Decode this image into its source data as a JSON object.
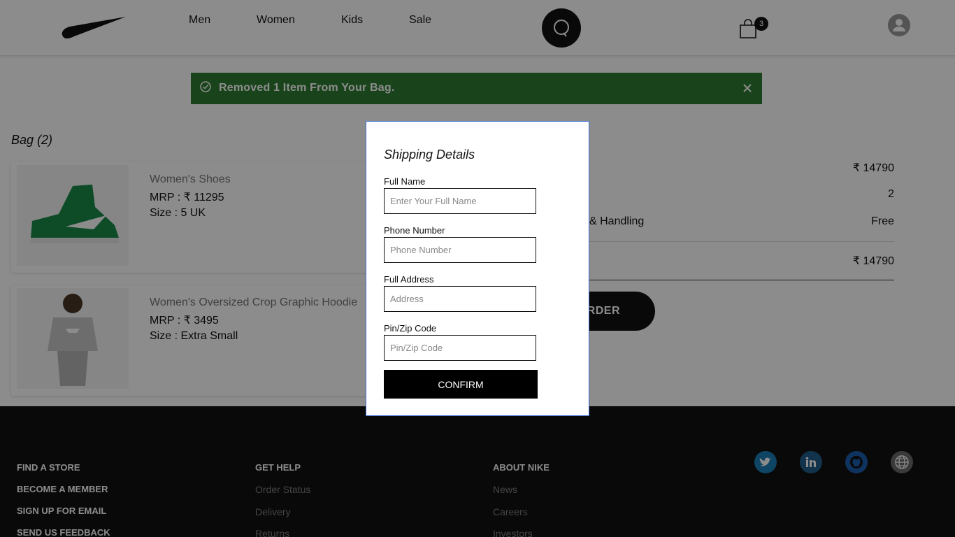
{
  "header": {
    "logo_icon": "nike-swoosh-logo",
    "nav": [
      {
        "label": "Men"
      },
      {
        "label": "Women"
      },
      {
        "label": "Kids"
      },
      {
        "label": "Sale"
      }
    ],
    "search_icon": "search-icon",
    "cart_icon": "shopping-bag-icon",
    "cart_count": "3",
    "avatar_icon": "user-avatar-icon"
  },
  "toast": {
    "icon": "check-circle-icon",
    "message": "Removed 1 Item From Your Bag.",
    "close_icon": "close-icon",
    "color": "#2e7d32"
  },
  "bag": {
    "title": "Bag (2)",
    "items": [
      {
        "name": "Women's Shoes",
        "price": "MRP : ₹ 11295",
        "size": "Size : 5 UK",
        "image": "green-high-top-sneaker"
      },
      {
        "name": "Women's Oversized Crop Graphic Hoodie",
        "price": "MRP : ₹ 3495",
        "size": "Size : Extra Small",
        "image": "grey-hoodie-model"
      }
    ]
  },
  "summary": {
    "subtotal_value": "₹ 14790",
    "items_value": "2",
    "shipping_label": "& Handling",
    "shipping_value": "Free",
    "total_value": "₹ 14790",
    "order_button": "RDER"
  },
  "footer": {
    "col1": [
      "FIND A STORE",
      "BECOME A MEMBER",
      "SIGN UP FOR EMAIL",
      "SEND US FEEDBACK"
    ],
    "col2_head": "GET HELP",
    "col2": [
      "Order Status",
      "Delivery",
      "Returns"
    ],
    "col3_head": "ABOUT NIKE",
    "col3": [
      "News",
      "Careers",
      "Investors"
    ],
    "social": [
      "twitter-icon",
      "linkedin-icon",
      "github-icon",
      "globe-icon"
    ]
  },
  "modal": {
    "title": "Shipping Details",
    "fields": [
      {
        "label": "Full Name",
        "placeholder": "Enter Your Full Name",
        "value": ""
      },
      {
        "label": "Phone Number",
        "placeholder": "Phone Number",
        "value": ""
      },
      {
        "label": "Full Address",
        "placeholder": "Address",
        "value": ""
      },
      {
        "label": "Pin/Zip Code",
        "placeholder": "Pin/Zip Code",
        "value": ""
      }
    ],
    "confirm_label": "CONFIRM"
  }
}
